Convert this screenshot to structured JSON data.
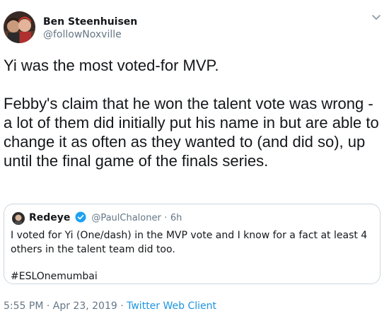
{
  "author": {
    "name": "Ben Steenhuisen",
    "handle": "@followNoxville"
  },
  "tweet": {
    "paragraphs": [
      "Yi was the most voted-for MVP.",
      "Febby's claim that he won the talent vote was wrong - a lot of them did initially put his name in but are able to change it as often as they wanted to (and did so), up until the final game of the finals series."
    ]
  },
  "quoted_tweet": {
    "name": "Redeye",
    "handle": "@PaulChaloner",
    "separator": "·",
    "time": "6h",
    "text": "I voted for Yi (One/dash) in the MVP vote and I know for a fact at least 4 others in the talent team did too.",
    "hashtag": "#ESLOnemumbai"
  },
  "meta": {
    "timestamp": "5:55 PM · Apr 23, 2019 · ",
    "source": "Twitter Web Client"
  },
  "icons": {
    "menu": "chevron-down-icon",
    "verified": "verified-badge-icon"
  },
  "colors": {
    "text": "#14171a",
    "secondary": "#657786",
    "link": "#1b95e0",
    "verified": "#1da1f2",
    "border": "#ccd6dd"
  }
}
